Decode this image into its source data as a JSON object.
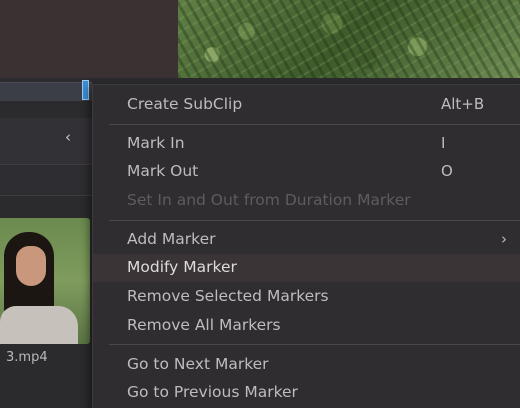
{
  "left_panel": {
    "thumbnail_filename": "3.mp4"
  },
  "context_menu": {
    "items": [
      {
        "label": "Create SubClip",
        "shortcut": "Alt+B"
      },
      {
        "label": "Mark In",
        "shortcut": "I"
      },
      {
        "label": "Mark Out",
        "shortcut": "O"
      },
      {
        "label": "Set In and Out from Duration Marker",
        "disabled": true
      },
      {
        "label": "Add Marker",
        "submenu": true
      },
      {
        "label": "Modify Marker",
        "highlighted": true
      },
      {
        "label": "Remove Selected Markers"
      },
      {
        "label": "Remove All Markers"
      },
      {
        "label": "Go to Next Marker"
      },
      {
        "label": "Go to Previous Marker"
      }
    ]
  }
}
